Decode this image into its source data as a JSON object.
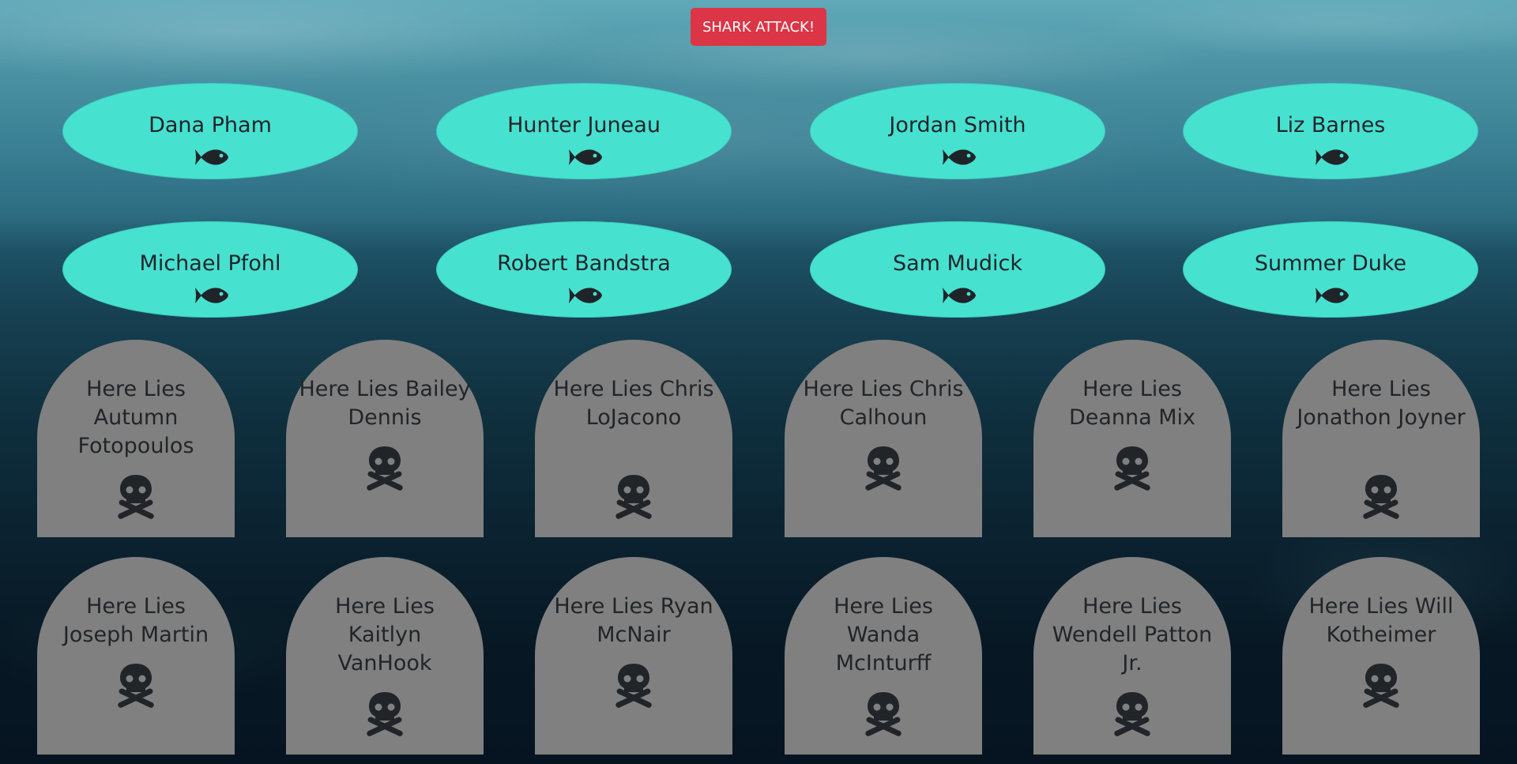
{
  "attack_button": {
    "label": "SHARK ATTACK!"
  },
  "colors": {
    "button": "#dc3545",
    "fish_card": "#47e1d0",
    "tombstone": "#808080",
    "text_dark": "#212529"
  },
  "fish": [
    {
      "name": "Dana Pham",
      "icon": "fish-icon"
    },
    {
      "name": "Hunter Juneau",
      "icon": "fish-icon"
    },
    {
      "name": "Jordan Smith",
      "icon": "fish-icon"
    },
    {
      "name": "Liz Barnes",
      "icon": "fish-icon"
    },
    {
      "name": "Michael Pfohl",
      "icon": "fish-icon"
    },
    {
      "name": "Robert Bandstra",
      "icon": "fish-icon"
    },
    {
      "name": "Sam Mudick",
      "icon": "fish-icon"
    },
    {
      "name": "Summer Duke",
      "icon": "fish-icon"
    }
  ],
  "graves": [
    {
      "text": "Here Lies Autumn Fotopoulos",
      "icon": "skull-crossbones-icon"
    },
    {
      "text": "Here Lies Bailey Dennis",
      "icon": "skull-crossbones-icon"
    },
    {
      "text": "Here Lies Chris LoJacono",
      "icon": "skull-crossbones-icon"
    },
    {
      "text": "Here Lies Chris Calhoun",
      "icon": "skull-crossbones-icon"
    },
    {
      "text": "Here Lies Deanna Mix",
      "icon": "skull-crossbones-icon"
    },
    {
      "text": "Here Lies Jonathon Joyner",
      "icon": "skull-crossbones-icon"
    },
    {
      "text": "Here Lies Joseph Martin",
      "icon": "skull-crossbones-icon"
    },
    {
      "text": "Here Lies Kaitlyn VanHook",
      "icon": "skull-crossbones-icon"
    },
    {
      "text": "Here Lies Ryan McNair",
      "icon": "skull-crossbones-icon"
    },
    {
      "text": "Here Lies Wanda McInturff",
      "icon": "skull-crossbones-icon"
    },
    {
      "text": "Here Lies Wendell Patton Jr.",
      "icon": "skull-crossbones-icon"
    },
    {
      "text": "Here Lies Will Kotheimer",
      "icon": "skull-crossbones-icon"
    }
  ]
}
